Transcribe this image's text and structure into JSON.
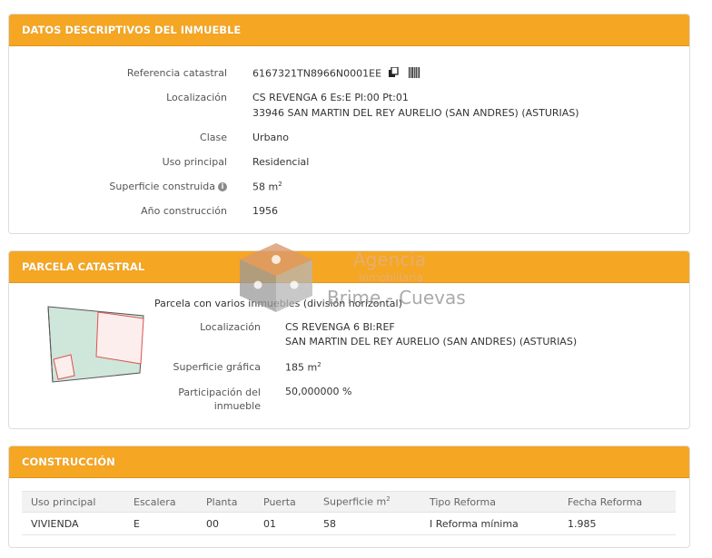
{
  "inmueble": {
    "title": "DATOS DESCRIPTIVOS DEL INMUEBLE",
    "rows": {
      "referencia": {
        "label": "Referencia catastral",
        "value": "6167321TN8966N0001EE"
      },
      "localizacion": {
        "label": "Localización",
        "line1": "CS REVENGA 6 Es:E Pl:00 Pt:01",
        "line2": "33946 SAN MARTIN DEL REY AURELIO (SAN ANDRES) (ASTURIAS)"
      },
      "clase": {
        "label": "Clase",
        "value": "Urbano"
      },
      "uso": {
        "label": "Uso principal",
        "value": "Residencial"
      },
      "superficie": {
        "label": "Superficie construida",
        "value": "58 m",
        "unit_sup": "2"
      },
      "anio": {
        "label": "Año construcción",
        "value": "1956"
      }
    }
  },
  "parcela": {
    "title": "PARCELA CATASTRAL",
    "note": "Parcela con varios inmuebles (división horizontal)",
    "localizacion": {
      "label": "Localización",
      "line1": "CS REVENGA 6 Bl:REF",
      "line2": "SAN MARTIN DEL REY AURELIO (SAN ANDRES) (ASTURIAS)"
    },
    "superficie": {
      "label": "Superficie gráfica",
      "value": "185 m",
      "unit_sup": "2"
    },
    "participacion": {
      "label_line1": "Participación del",
      "label_line2": "inmueble",
      "value": "50,000000 %"
    }
  },
  "construccion": {
    "title": "CONSTRUCCIÓN",
    "headers": [
      "Uso principal",
      "Escalera",
      "Planta",
      "Puerta",
      "Superficie m",
      "Tipo Reforma",
      "Fecha Reforma"
    ],
    "header_sup": "2",
    "rows": [
      [
        "VIVIENDA",
        "E",
        "00",
        "01",
        "58",
        "I Reforma mínima",
        "1.985"
      ]
    ]
  },
  "watermark": {
    "line1": "Agencia",
    "line2": "Inmobiliaria",
    "line3": "Brime - Cuevas"
  },
  "colors": {
    "header_orange": "#f5a623",
    "parcel_green": "#cfe6da",
    "parcel_red": "#d9534f"
  },
  "icons": [
    "copy-icon",
    "barcode-icon",
    "info-icon",
    "logo-cube-icon",
    "parcel-map-icon"
  ]
}
